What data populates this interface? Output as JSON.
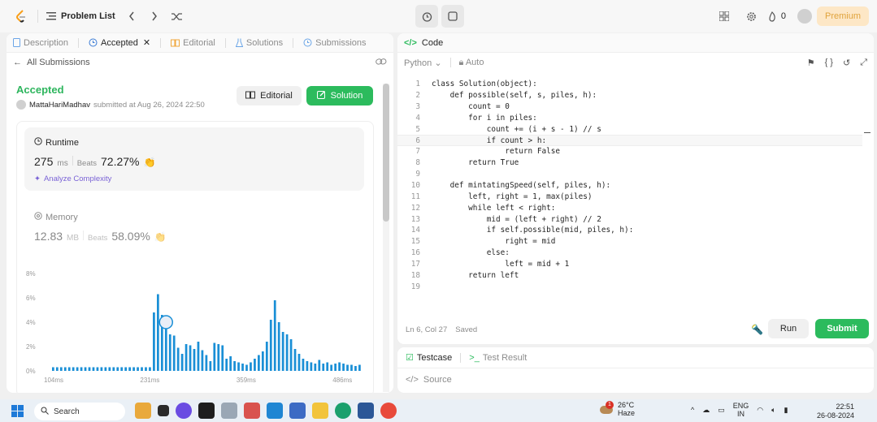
{
  "topbar": {
    "problem_list": "Problem List",
    "flame_count": "0",
    "premium": "Premium"
  },
  "left_tabs": [
    {
      "label": "Description",
      "icon": "description-icon"
    },
    {
      "label": "Accepted",
      "icon": "history-icon"
    },
    {
      "label": "Editorial",
      "icon": "book-icon"
    },
    {
      "label": "Solutions",
      "icon": "flask-icon"
    },
    {
      "label": "Submissions",
      "icon": "history-icon"
    }
  ],
  "submission": {
    "back": "All Submissions",
    "status": "Accepted",
    "user": "MattaHariMadhav",
    "submitted_at": "submitted at Aug 26, 2024 22:50",
    "editorial_btn": "Editorial",
    "solution_btn": "Solution"
  },
  "runtime": {
    "title": "Runtime",
    "value": "275",
    "unit": "ms",
    "beats_label": "Beats",
    "beats": "72.27%",
    "analyze": "Analyze Complexity"
  },
  "memory": {
    "title": "Memory",
    "value": "12.83",
    "unit": "MB",
    "beats_label": "Beats",
    "beats": "58.09%"
  },
  "chart_data": {
    "type": "bar",
    "y_ticks": [
      "8%",
      "6%",
      "4%",
      "2%",
      "0%"
    ],
    "x_ticks": [
      "104ms",
      "231ms",
      "359ms",
      "486ms"
    ],
    "ylim": [
      0,
      8
    ],
    "values": [
      0.3,
      0.3,
      0.3,
      0.3,
      0.3,
      0.3,
      0.3,
      0.3,
      0.3,
      0.3,
      0.3,
      0.3,
      0.3,
      0.3,
      0.3,
      0.3,
      0.3,
      0.3,
      0.3,
      0.3,
      0.3,
      0.3,
      0.3,
      0.3,
      0.3,
      4.8,
      6.3,
      4.6,
      3.6,
      3.0,
      2.9,
      1.9,
      1.4,
      2.2,
      2.1,
      1.8,
      2.4,
      1.7,
      1.3,
      0.8,
      2.3,
      2.2,
      2.1,
      1.0,
      1.2,
      0.8,
      0.7,
      0.6,
      0.5,
      0.7,
      1.0,
      1.3,
      1.6,
      2.4,
      4.2,
      5.8,
      4.0,
      3.2,
      3.0,
      2.6,
      1.8,
      1.4,
      1.0,
      0.8,
      0.7,
      0.6,
      0.9,
      0.6,
      0.7,
      0.5,
      0.6,
      0.7,
      0.6,
      0.5,
      0.5,
      0.4,
      0.5
    ],
    "color": "#1a8fd6"
  },
  "editor": {
    "title": "Code",
    "language": "Python",
    "mode": "Auto",
    "lines": [
      "class Solution(object):",
      "    def possible(self, s, piles, h):",
      "        count = 0",
      "        for i in piles:",
      "            count += (i + s - 1) // s",
      "            if count > h:",
      "                return False",
      "        return True",
      "",
      "    def mintatingSpeed(self, piles, h):",
      "        left, right = 1, max(piles)",
      "        while left < right:",
      "            mid = (left + right) // 2",
      "            if self.possible(mid, piles, h):",
      "                right = mid",
      "            else:",
      "                left = mid + 1",
      "        return left",
      ""
    ],
    "status_pos": "Ln 6, Col 27",
    "status_saved": "Saved",
    "run": "Run",
    "submit": "Submit"
  },
  "bottom": {
    "testcase": "Testcase",
    "test_result": "Test Result",
    "source": "Source"
  },
  "taskbar": {
    "search": "Search",
    "temp": "26°C",
    "weather": "Haze",
    "lang1": "ENG",
    "lang2": "IN",
    "time": "22:51",
    "date": "26-08-2024",
    "badge": "1"
  }
}
